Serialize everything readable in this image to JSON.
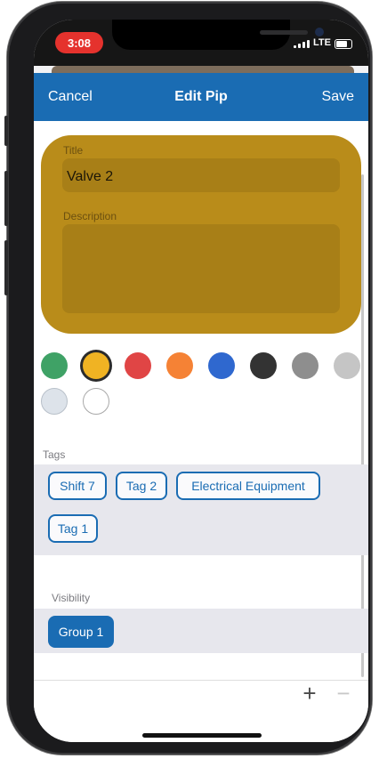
{
  "status_bar": {
    "time": "3:08",
    "network": "LTE"
  },
  "nav": {
    "cancel": "Cancel",
    "title": "Edit Pip",
    "save": "Save"
  },
  "form": {
    "title_label": "Title",
    "title_value": "Valve 2",
    "description_label": "Description",
    "description_value": ""
  },
  "colors": {
    "selected": "#f0b323",
    "swatches": [
      "#3fa266",
      "#f0b323",
      "#e04545",
      "#f58235",
      "#2f68cf",
      "#333333",
      "#8e8e8e",
      "#c5c5c5",
      "#dde3ea",
      "#ffffff"
    ]
  },
  "tags": {
    "label": "Tags",
    "items": [
      "Shift 7",
      "Tag 2",
      "Electrical Equipment",
      "Tag 1"
    ]
  },
  "visibility": {
    "label": "Visibility",
    "groups": [
      "Group 1"
    ]
  },
  "toolbar": {
    "add": "+",
    "remove": "−"
  },
  "theme": {
    "accent": "#1a6cb3",
    "card": "#b98c1a"
  }
}
